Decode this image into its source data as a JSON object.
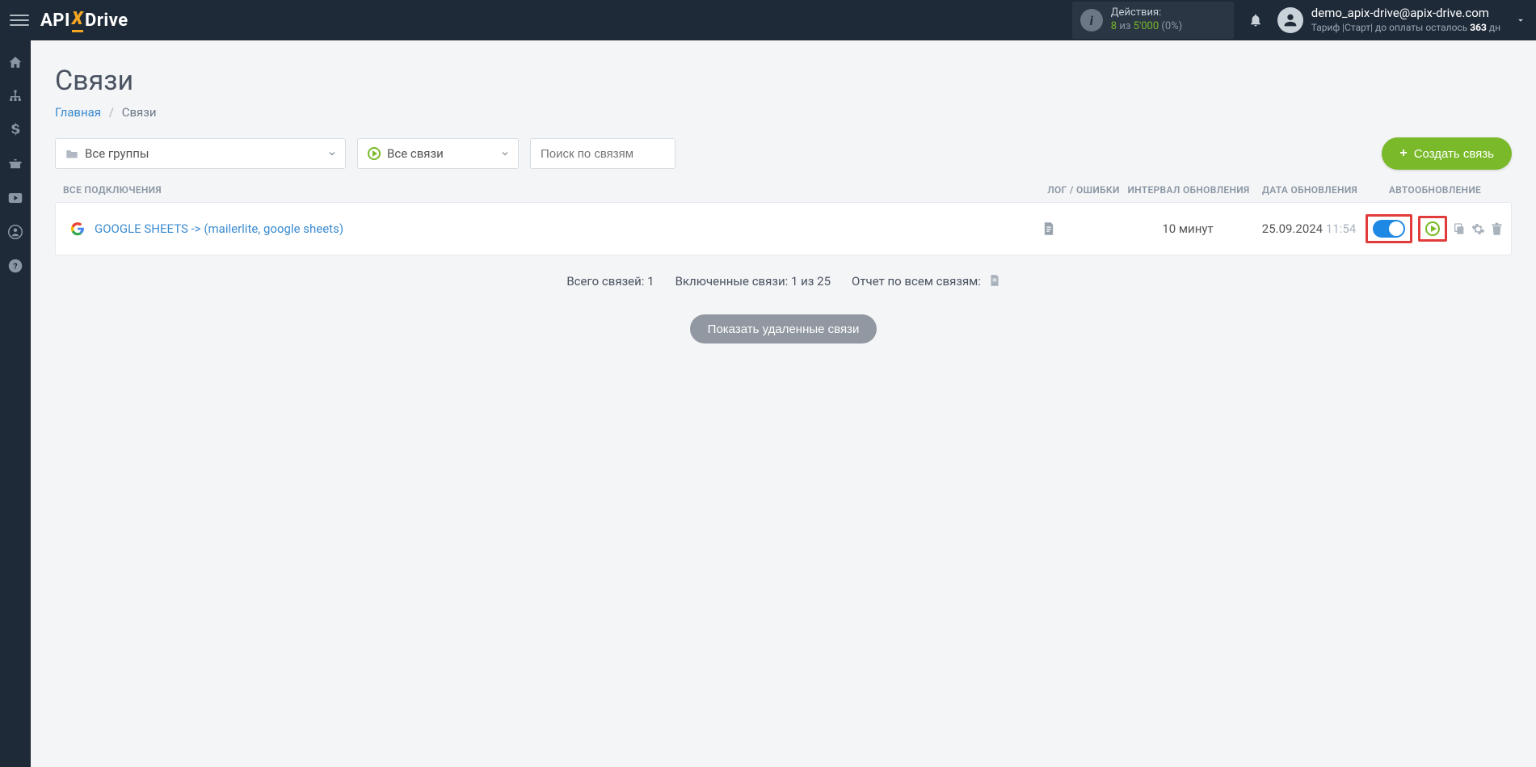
{
  "header": {
    "logo_parts": {
      "api": "API",
      "x": "X",
      "drive": "Drive"
    },
    "actions_box": {
      "label": "Действия:",
      "used": "8",
      "of_word": "из",
      "limit": "5'000",
      "percent": "(0%)"
    },
    "user": {
      "email": "demo_apix-drive@apix-drive.com",
      "tariff_prefix": "Тариф |Старт| до оплаты осталось ",
      "days": "363",
      "days_suffix": " дн"
    }
  },
  "sidebar": {
    "items": [
      "home",
      "sitemap",
      "dollar",
      "briefcase",
      "video",
      "user",
      "help"
    ]
  },
  "page": {
    "title": "Связи",
    "breadcrumb_home": "Главная",
    "breadcrumb_current": "Связи"
  },
  "filters": {
    "groups_label": "Все группы",
    "status_label": "Все связи",
    "search_placeholder": "Поиск по связям",
    "create_label": "Создать связь"
  },
  "columns": {
    "connections": "ВСЕ ПОДКЛЮЧЕНИЯ",
    "log": "ЛОГ / ОШИБКИ",
    "interval": "ИНТЕРВАЛ ОБНОВЛЕНИЯ",
    "date": "ДАТА ОБНОВЛЕНИЯ",
    "auto": "АВТООБНОВЛЕНИЕ"
  },
  "rows": [
    {
      "name": "GOOGLE SHEETS -> (mailerlite, google sheets)",
      "interval": "10 минут",
      "date": "25.09.2024",
      "time": "11:54",
      "auto_on": true
    }
  ],
  "summary": {
    "total": "Всего связей: 1",
    "enabled": "Включенные связи: 1 из 25",
    "report": "Отчет по всем связям:"
  },
  "show_deleted": "Показать удаленные связи"
}
